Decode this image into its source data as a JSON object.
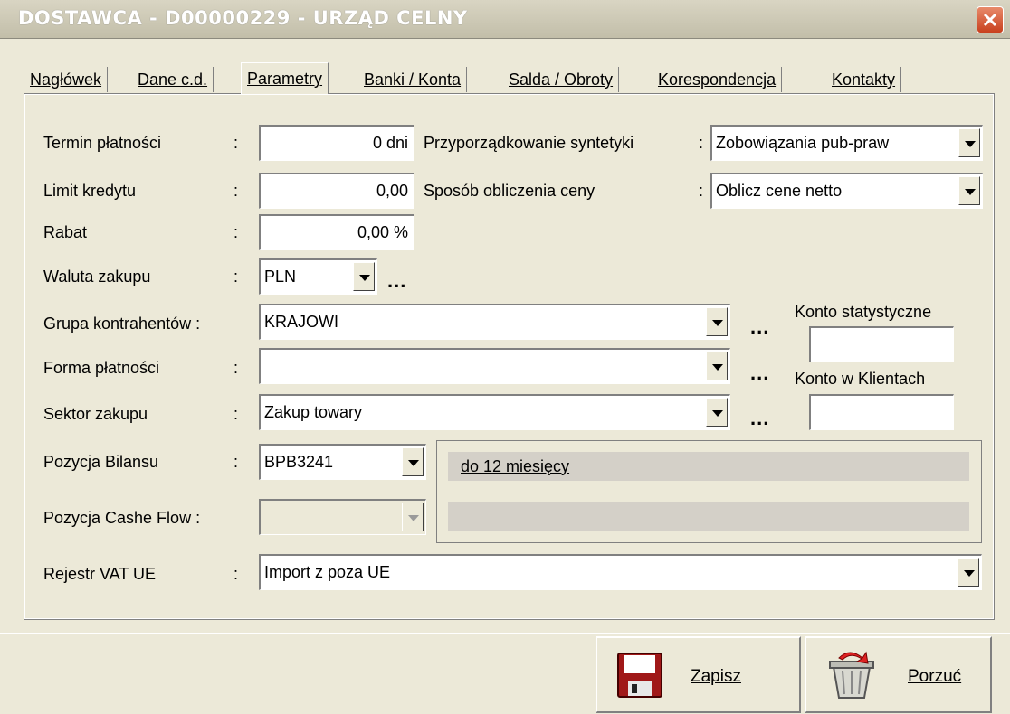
{
  "window": {
    "title": "DOSTAWCA - D00000229 - URZĄD CELNY"
  },
  "tabs": [
    {
      "label": "Nagłówek"
    },
    {
      "label": "Dane c.d."
    },
    {
      "label": "Parametry"
    },
    {
      "label": "Banki / Konta"
    },
    {
      "label": "Salda / Obroty"
    },
    {
      "label": "Korespondencja"
    },
    {
      "label": "Kontakty"
    }
  ],
  "form": {
    "termin_platnosci": {
      "label": "Termin płatności",
      "value": "0 dni"
    },
    "limit_kredytu": {
      "label": "Limit kredytu",
      "value": "0,00"
    },
    "rabat": {
      "label": "Rabat",
      "value": "0,00 %"
    },
    "waluta_zakupu": {
      "label": "Waluta zakupu",
      "value": "PLN"
    },
    "grupa_kontrahentow": {
      "label": "Grupa kontrahentów :",
      "value": "KRAJOWI"
    },
    "forma_platnosci": {
      "label": "Forma płatności",
      "value": ""
    },
    "sektor_zakupu": {
      "label": "Sektor zakupu",
      "value": "Zakup towary"
    },
    "pozycja_bilansu": {
      "label": "Pozycja Bilansu",
      "value": "BPB3241",
      "description": "do 12 miesięcy"
    },
    "pozycja_cashe_flow": {
      "label": "Pozycja Cashe Flow :",
      "value": ""
    },
    "rejestr_vat_ue": {
      "label": "Rejestr VAT UE",
      "value": "Import z poza UE"
    },
    "przyporzadkowanie": {
      "label": "Przyporządkowanie syntetyki",
      "value": "Zobowiązania pub-praw"
    },
    "sposob_obliczenia": {
      "label": "Sposób obliczenia ceny",
      "value": "Oblicz cene netto"
    },
    "konto_statystyczne": {
      "label": "Konto statystyczne",
      "value": ""
    },
    "konto_w_klientach": {
      "label": "Konto w Klientach",
      "value": ""
    }
  },
  "colon": ":",
  "ellipsis": "...",
  "buttons": {
    "save": "Zapisz",
    "cancel": "Porzuć"
  }
}
